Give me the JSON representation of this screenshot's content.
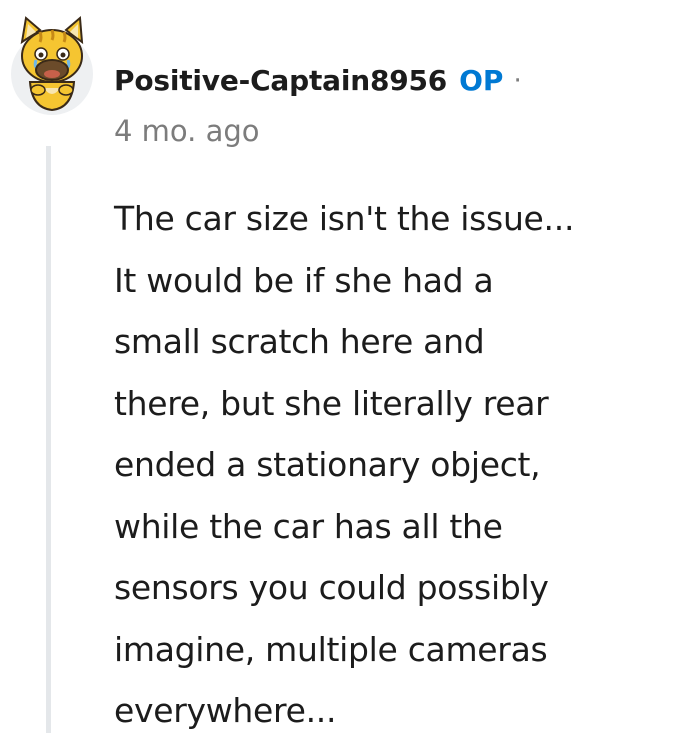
{
  "comment": {
    "avatar_icon": "cartoon-yellow-animal-avatar-icon",
    "username": "Positive-Captain8956",
    "op_badge": "OP",
    "separator": "·",
    "timestamp": "4 mo. ago",
    "body_lines": [
      "The car size isn't the issue...",
      "It would be if she had a",
      "small scratch here and",
      "there, but she literally rear",
      "ended a stationary object,",
      "while the car has all the",
      "sensors you could possibly",
      "imagine, multiple cameras",
      "everywhere..."
    ]
  },
  "colors": {
    "text": "#1c1c1c",
    "meta": "#7c7c7c",
    "op_blue": "#0079d3",
    "thread_line": "#e4e7ea",
    "avatar_yellow": "#f5c531",
    "avatar_brown": "#6b4b2a"
  }
}
